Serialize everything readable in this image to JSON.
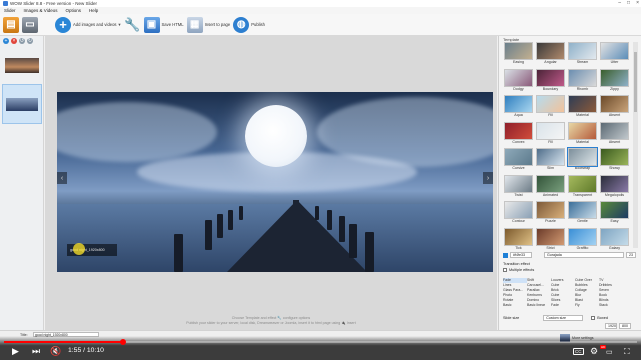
{
  "window": {
    "title": "WOW Slider 8.8 - Free version - New Slider",
    "controls": [
      "–",
      "□",
      "×"
    ]
  },
  "menu": [
    "Slider",
    "Images & Videos",
    "Options",
    "Help"
  ],
  "toolbar": {
    "add_label": "Add images and videos",
    "save_label": "Save HTML",
    "insert_label": "Insert to page",
    "publish_label": "Publish"
  },
  "slide": {
    "caption": "good night_1920x800",
    "prev": "‹",
    "next": "›"
  },
  "hint": {
    "line1": "Choose Template and effect 🔧 configure options",
    "line2": "Publish your slider to your server, local disk, Dreamweaver or Joomla, insert it to html page using 🔌 Insert"
  },
  "template_panel": {
    "title": "Template",
    "templates": [
      {
        "name": "Easing",
        "colors": [
          "#6a7f8c",
          "#c3b090"
        ]
      },
      {
        "name": "Angular",
        "colors": [
          "#3a3a3a",
          "#b08a6c"
        ]
      },
      {
        "name": "Stream",
        "colors": [
          "#8fb1c9",
          "#e3e9ee"
        ]
      },
      {
        "name": "Utter",
        "colors": [
          "#e2e2e2",
          "#5b8db8"
        ]
      },
      {
        "name": "Dodgy",
        "colors": [
          "#d9dfe5",
          "#8a5a7a"
        ]
      },
      {
        "name": "Boundary",
        "colors": [
          "#4b2438",
          "#c05a8a"
        ]
      },
      {
        "name": "Rhomb",
        "colors": [
          "#6b8eb0",
          "#d9d9d9"
        ]
      },
      {
        "name": "Zippy",
        "colors": [
          "#3a5e2b",
          "#8fb1c9"
        ]
      },
      {
        "name": "Aqua",
        "colors": [
          "#2f7fbf",
          "#a9d6f0"
        ]
      },
      {
        "name": "Fill",
        "colors": [
          "#b6dbee",
          "#f2c29a"
        ]
      },
      {
        "name": "Material",
        "colors": [
          "#2f3d55",
          "#8b5a3a"
        ]
      },
      {
        "name": "Absent",
        "colors": [
          "#6b4a2a",
          "#caa47a"
        ]
      },
      {
        "name": "Convex",
        "colors": [
          "#8f1f2a",
          "#d14d3b"
        ]
      },
      {
        "name": "Fill",
        "colors": [
          "#d9e3ea",
          "#f5f5f5"
        ]
      },
      {
        "name": "Material",
        "colors": [
          "#e7d7a5",
          "#b55a3a"
        ]
      },
      {
        "name": "Absent",
        "colors": [
          "#5c6a74",
          "#c1c8cc"
        ]
      },
      {
        "name": "Cursive",
        "colors": [
          "#8ea9b9",
          "#5c7a8c"
        ]
      },
      {
        "name": "Slim",
        "colors": [
          "#4f6d8a",
          "#d8e5ef"
        ]
      },
      {
        "name": "Bootstrap",
        "colors": [
          "#7c8f9b",
          "#dfe6ea"
        ]
      },
      {
        "name": "Showy",
        "colors": [
          "#3a5a1e",
          "#9ab45a"
        ]
      },
      {
        "name": "Twist",
        "colors": [
          "#e2e7ec",
          "#6c7b86"
        ]
      },
      {
        "name": "Animated",
        "colors": [
          "#33543a",
          "#7aa07e"
        ]
      },
      {
        "name": "Transparent",
        "colors": [
          "#a5b95e",
          "#5f7a2a"
        ]
      },
      {
        "name": "Megalopolis",
        "colors": [
          "#2b2e3a",
          "#8a7aa8"
        ]
      },
      {
        "name": "Contour",
        "colors": [
          "#e9e9e9",
          "#8aa0b5"
        ]
      },
      {
        "name": "Puzzle",
        "colors": [
          "#7d5a3a",
          "#d9b07a"
        ]
      },
      {
        "name": "Gentle",
        "colors": [
          "#3b6f9a",
          "#c9dbe8"
        ]
      },
      {
        "name": "Easy",
        "colors": [
          "#5a8a3a",
          "#1d3b64"
        ]
      },
      {
        "name": "Tick",
        "colors": [
          "#7c5a2e",
          "#e0c186"
        ]
      },
      {
        "name": "Strict",
        "colors": [
          "#6b3b2a",
          "#d39b73"
        ]
      },
      {
        "name": "Graffito",
        "colors": [
          "#3a8fd6",
          "#a3d2f2"
        ]
      },
      {
        "name": "Galaxy",
        "colors": [
          "#7fa5c2",
          "#c4dbe9"
        ]
      }
    ],
    "color_value": "#f4fe33",
    "font_value": "Gurajada",
    "font_size": "23",
    "transition_label": "Transition effect",
    "multiple_effects_label": "Multiple effects",
    "effects": [
      "Fade",
      "Shift",
      "Louvers",
      "Cube Over",
      "TV",
      "Lines",
      "Carousel...",
      "Cube",
      "Bubbles",
      "Dribbles",
      "Glass Para...",
      "Parallax",
      "Brick",
      "Collage",
      "Seven",
      "Photo",
      "Kenburns",
      "Cube",
      "Blur",
      "Book",
      "Rotate",
      "Domino",
      "Slices",
      "Blast",
      "Blinds",
      "Basic",
      "Basic linear",
      "Fade",
      "Fly",
      "Stack"
    ],
    "slide_size_label": "Slide size",
    "slide_size_value": "Custom size",
    "boxed_label": "Boxed",
    "width_value": "1920",
    "height_value": "800"
  },
  "properties": {
    "title_label": "Title:",
    "title_value": "good night_1920x800"
  },
  "player": {
    "time": "1:55 / 10:10",
    "progress": 0.188,
    "hd": "HD",
    "cc": "CC"
  },
  "footer": {
    "more_settings": "More settings"
  }
}
